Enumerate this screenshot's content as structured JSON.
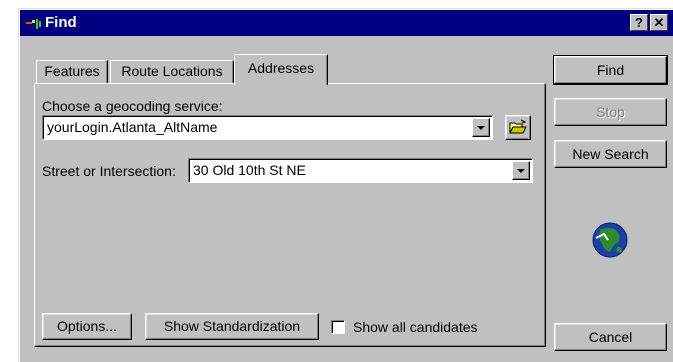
{
  "window": {
    "title": "Find",
    "help_label": "?",
    "close_label": "✕"
  },
  "tabs": [
    {
      "label": "Features"
    },
    {
      "label": "Route Locations"
    },
    {
      "label": "Addresses"
    }
  ],
  "geocoding": {
    "label": "Choose a geocoding service:",
    "value": "yourLogin.Atlanta_AltName"
  },
  "street": {
    "label": "Street or Intersection:",
    "value": "30 Old 10th St NE"
  },
  "buttons": {
    "find": "Find",
    "stop": "Stop",
    "new_search": "New Search",
    "options": "Options...",
    "show_standardization": "Show Standardization",
    "cancel": "Cancel"
  },
  "show_all_candidates": {
    "label": "Show all candidates",
    "checked": false
  },
  "icons": {
    "title": "find-app-icon",
    "folder": "open-folder-icon",
    "globe": "globe-icon"
  }
}
